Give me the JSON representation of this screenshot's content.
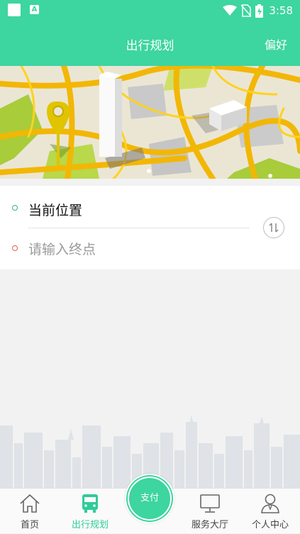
{
  "status_bar": {
    "time": "3:58"
  },
  "header": {
    "title": "出行规划",
    "right_action": "偏好"
  },
  "route": {
    "start_label": "当前位置",
    "end_placeholder": "请输入终点"
  },
  "banner": {
    "page_count": 2,
    "active_page": 1
  },
  "tabs": [
    {
      "label": "首页",
      "icon": "home-icon",
      "active": false
    },
    {
      "label": "出行规划",
      "icon": "bus-icon",
      "active": true
    },
    {
      "label": "支付",
      "icon": "pay-button",
      "active": false
    },
    {
      "label": "服务大厅",
      "icon": "monitor-icon",
      "active": false
    },
    {
      "label": "个人中心",
      "icon": "person-icon",
      "active": false
    }
  ],
  "colors": {
    "brand": "#3dd5a0",
    "active_tab": "#2ecc99",
    "start_dot": "#3cb371",
    "end_dot": "#e0604a"
  }
}
